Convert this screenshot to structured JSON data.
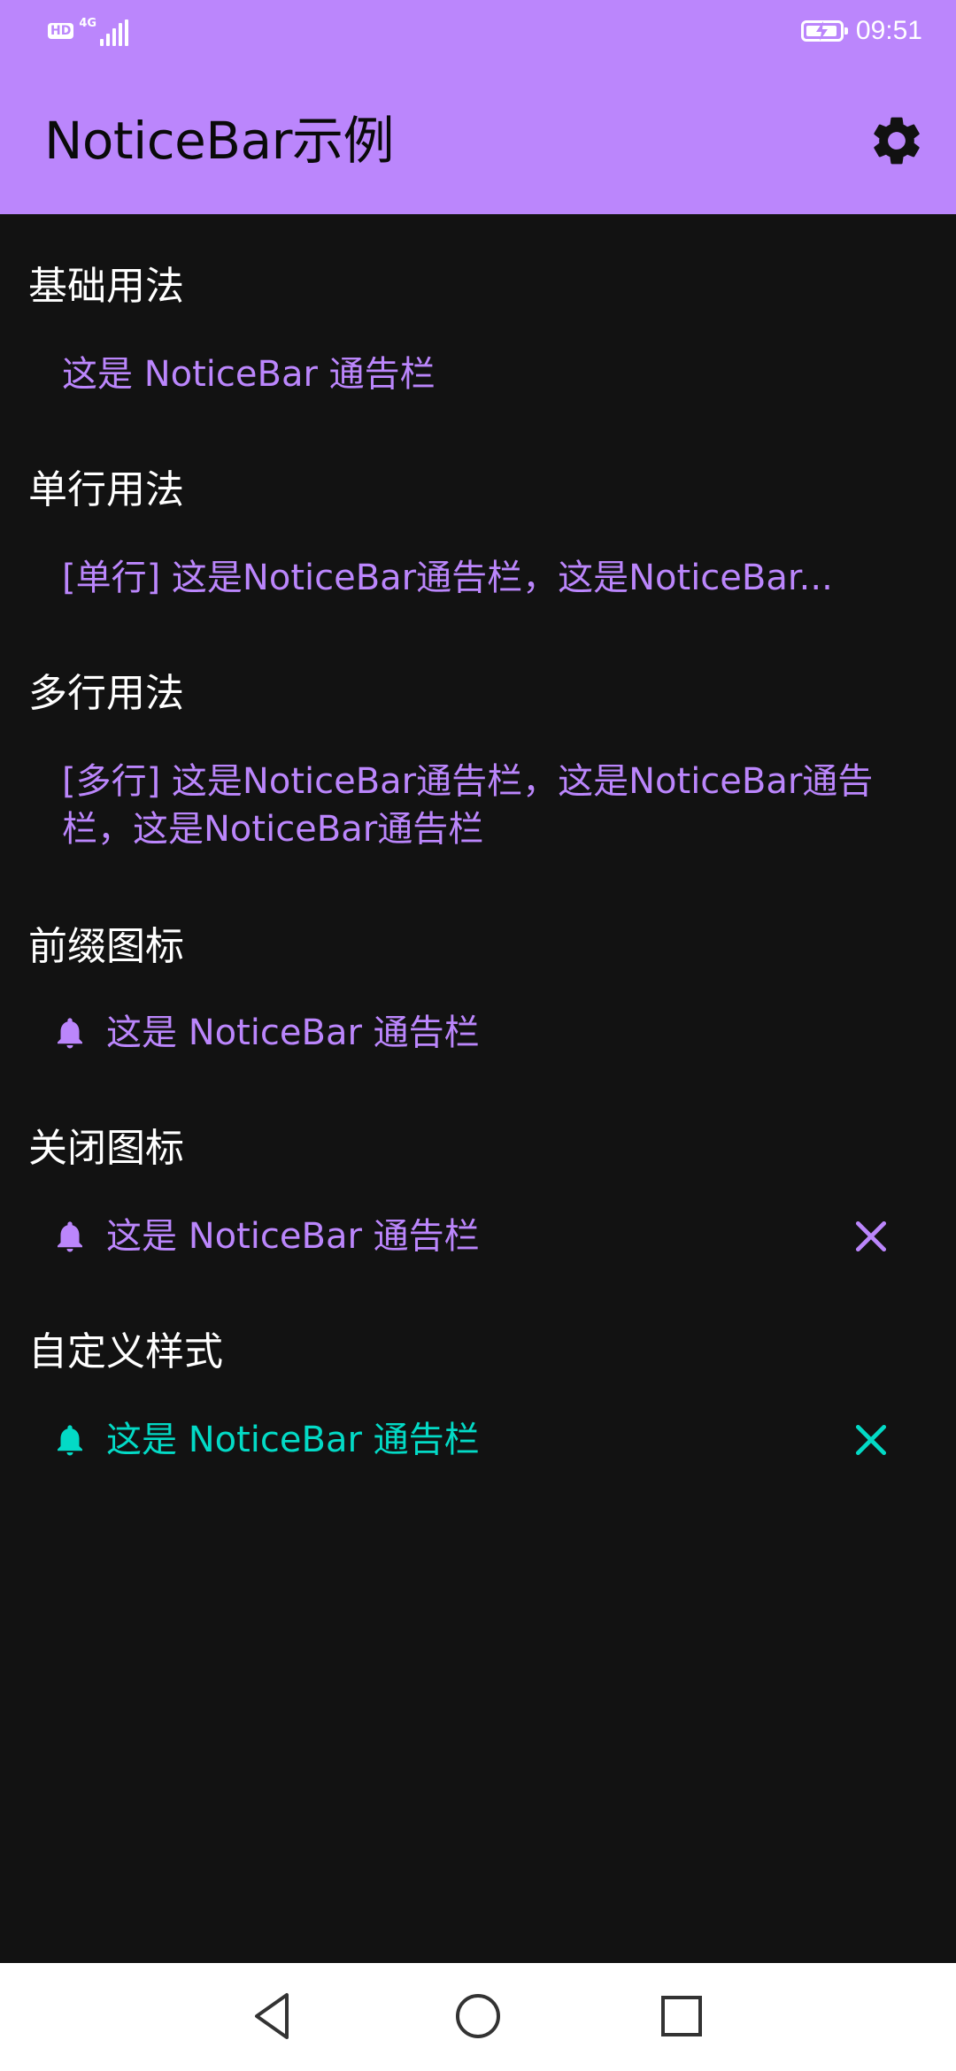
{
  "status_bar": {
    "hd_badge": "HD",
    "network": "4G",
    "time": "09:51"
  },
  "app_bar": {
    "title": "NoticeBar示例",
    "settings_icon": "gear-icon"
  },
  "sections": {
    "basic": {
      "title": "基础用法",
      "text": "这是 NoticeBar 通告栏"
    },
    "single_line": {
      "title": "单行用法",
      "text": "[单行] 这是NoticeBar通告栏，这是NoticeBar..."
    },
    "multi_line": {
      "title": "多行用法",
      "text": "[多行] 这是NoticeBar通告栏，这是NoticeBar通告栏，这是NoticeBar通告栏"
    },
    "prefix_icon": {
      "title": "前缀图标",
      "text": "这是 NoticeBar 通告栏",
      "icon": "bell-icon"
    },
    "close_icon": {
      "title": "关闭图标",
      "text": "这是 NoticeBar 通告栏",
      "icon": "bell-icon",
      "close": "close-icon"
    },
    "custom_style": {
      "title": "自定义样式",
      "text": "这是 NoticeBar 通告栏",
      "icon": "bell-icon",
      "close": "close-icon"
    }
  },
  "nav_bar": {
    "back": "back-triangle-icon",
    "home": "home-circle-icon",
    "recents": "recents-square-icon"
  },
  "colors": {
    "primary": "#bb86fc",
    "secondary": "#03dac6",
    "background": "#121212"
  }
}
